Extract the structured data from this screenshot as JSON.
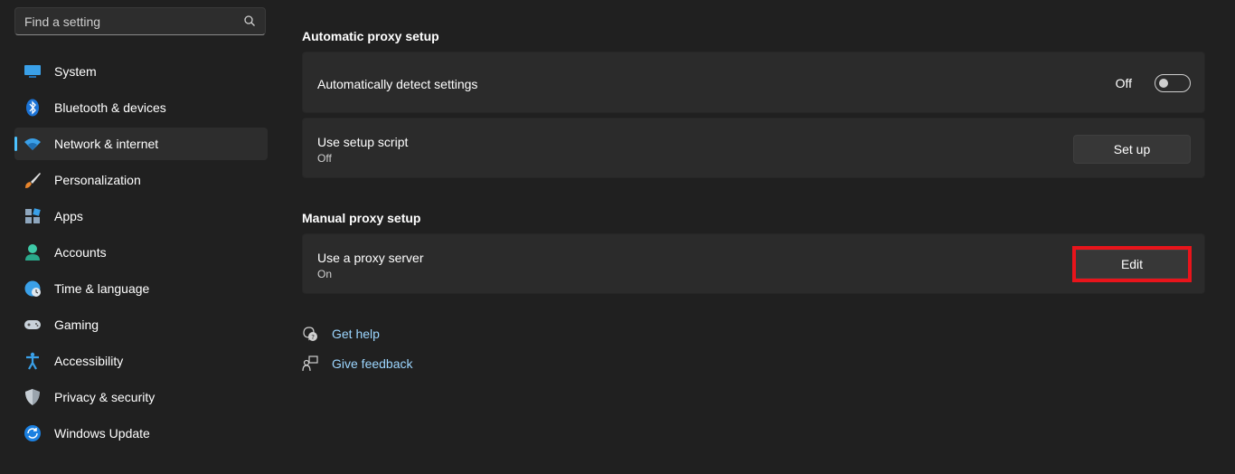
{
  "search": {
    "placeholder": "Find a setting"
  },
  "sidebar": {
    "items": [
      {
        "label": "System",
        "icon": "system-icon"
      },
      {
        "label": "Bluetooth & devices",
        "icon": "bluetooth-icon"
      },
      {
        "label": "Network & internet",
        "icon": "network-icon",
        "active": true
      },
      {
        "label": "Personalization",
        "icon": "brush-icon"
      },
      {
        "label": "Apps",
        "icon": "apps-icon"
      },
      {
        "label": "Accounts",
        "icon": "accounts-icon"
      },
      {
        "label": "Time & language",
        "icon": "time-language-icon"
      },
      {
        "label": "Gaming",
        "icon": "gamepad-icon"
      },
      {
        "label": "Accessibility",
        "icon": "accessibility-icon"
      },
      {
        "label": "Privacy & security",
        "icon": "shield-icon"
      },
      {
        "label": "Windows Update",
        "icon": "update-icon"
      }
    ]
  },
  "main": {
    "automatic": {
      "title": "Automatic proxy setup",
      "detect": {
        "label": "Automatically detect settings",
        "state": "Off"
      },
      "script": {
        "label": "Use setup script",
        "status": "Off",
        "button": "Set up"
      }
    },
    "manual": {
      "title": "Manual proxy setup",
      "proxy": {
        "label": "Use a proxy server",
        "status": "On",
        "button": "Edit"
      }
    },
    "links": {
      "help": "Get help",
      "feedback": "Give feedback"
    }
  },
  "colors": {
    "background": "#202020",
    "card": "#2b2b2b",
    "accent": "#4cc2ff",
    "link": "#9cd6ff",
    "highlight": "#e8141b"
  }
}
